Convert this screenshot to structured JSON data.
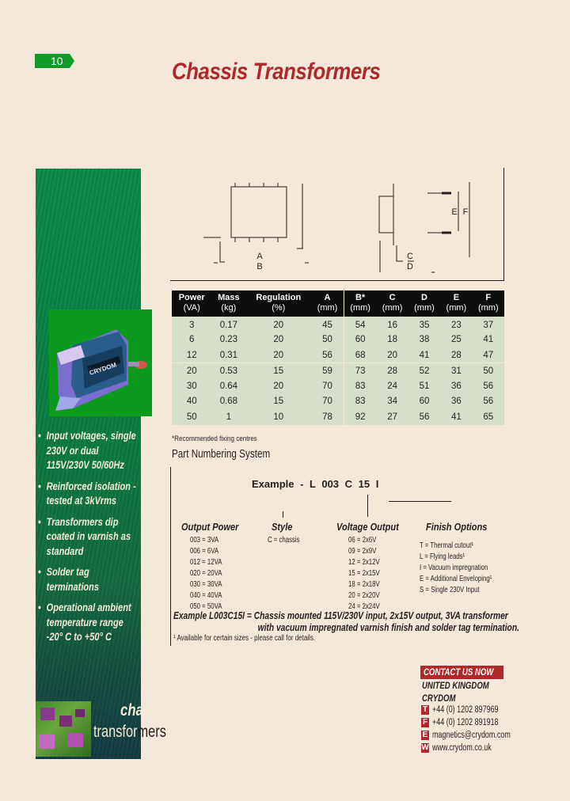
{
  "page": {
    "number": "10",
    "title": "Chassis Transformers"
  },
  "sidebar": {
    "bullets": [
      "Input voltages, single 230V or dual 115V/230V 50/60Hz",
      "Reinforced isolation - tested at 3kVrms",
      "Transformers dip coated in varnish as standard",
      "Solder tag terminations",
      "Operational ambient temperature range -20° C to +50° C"
    ],
    "brand_line1": "chassis",
    "brand_line2a": "transfor",
    "brand_line2b": "mers",
    "photo_label": "CRYDOM"
  },
  "diagram": {
    "labels": {
      "A": "A",
      "B": "B",
      "C": "C",
      "D": "D",
      "E": "E",
      "F": "F"
    }
  },
  "spec_table": {
    "headers": [
      {
        "name": "Power",
        "unit": "(VA)"
      },
      {
        "name": "Mass",
        "unit": "(kg)"
      },
      {
        "name": "Regulation",
        "unit": "(%)"
      },
      {
        "name": "A",
        "unit": "(mm)"
      },
      {
        "name": "B*",
        "unit": "(mm)"
      },
      {
        "name": "C",
        "unit": "(mm)"
      },
      {
        "name": "D",
        "unit": "(mm)"
      },
      {
        "name": "E",
        "unit": "(mm)"
      },
      {
        "name": "F",
        "unit": "(mm)"
      }
    ],
    "rows": [
      [
        "3",
        "0.17",
        "20",
        "45",
        "54",
        "16",
        "35",
        "23",
        "37"
      ],
      [
        "6",
        "0.23",
        "20",
        "50",
        "60",
        "18",
        "38",
        "25",
        "41"
      ],
      [
        "12",
        "0.31",
        "20",
        "56",
        "68",
        "20",
        "41",
        "28",
        "47"
      ],
      [
        "20",
        "0.53",
        "15",
        "59",
        "73",
        "28",
        "52",
        "31",
        "50"
      ],
      [
        "30",
        "0.64",
        "20",
        "70",
        "83",
        "24",
        "51",
        "36",
        "56"
      ],
      [
        "40",
        "0.68",
        "15",
        "70",
        "83",
        "34",
        "60",
        "36",
        "56"
      ],
      [
        "50",
        "1",
        "10",
        "78",
        "92",
        "27",
        "56",
        "41",
        "65"
      ]
    ],
    "footnote": "*Recommended fixing centres"
  },
  "part_numbering": {
    "title": "Part Numbering System",
    "example": "Example - L  003  C  15  I",
    "columns": [
      {
        "heading": "Output Power",
        "items": [
          "003 = 3VA",
          "006 = 6VA",
          "012 = 12VA",
          "020 = 20VA",
          "030 = 30VA",
          "040 = 40VA",
          "050 = 50VA"
        ]
      },
      {
        "heading": "Style",
        "items": [
          "C = chassis"
        ]
      },
      {
        "heading": "Voltage Output",
        "items": [
          "06 = 2x6V",
          "09 = 2x9V",
          "12 = 2x12V",
          "15 = 2x15V",
          "18 = 2x18V",
          "20 = 2x20V",
          "24 = 2x24V"
        ]
      },
      {
        "heading": "Finish Options",
        "items": [
          "T = Thermal cutout¹",
          "L = Flying leads¹",
          "I = Vacuum impregnation",
          "E = Additional Enveloping¹",
          "S = Single 230V Input"
        ]
      }
    ],
    "example_desc_label": "Example L003C15I =",
    "example_desc_line1": "Chassis mounted 115V/230V input, 2x15V output, 3VA transformer",
    "example_desc_line2": "with vacuum impregnated varnish finish and solder tag termination.",
    "footnote": "¹ Available for certain sizes - please call for details."
  },
  "contact": {
    "heading": "CONTACT US NOW",
    "region": "UNITED KINGDOM",
    "company": "CRYDOM",
    "rows": [
      {
        "badge": "T",
        "value": "+44 (0) 1202 897969"
      },
      {
        "badge": "F",
        "value": "+44 (0) 1202 891918"
      },
      {
        "badge": "E",
        "value": "magnetics@crydom.com"
      },
      {
        "badge": "W",
        "value": "www.crydom.co.uk"
      }
    ]
  },
  "colors": {
    "background": "#f3e8d9",
    "accent_red": "#b0282a",
    "tab_green": "#0f9a2a",
    "table_header": "#0d0d0d",
    "table_row": "#d6dfcc"
  }
}
